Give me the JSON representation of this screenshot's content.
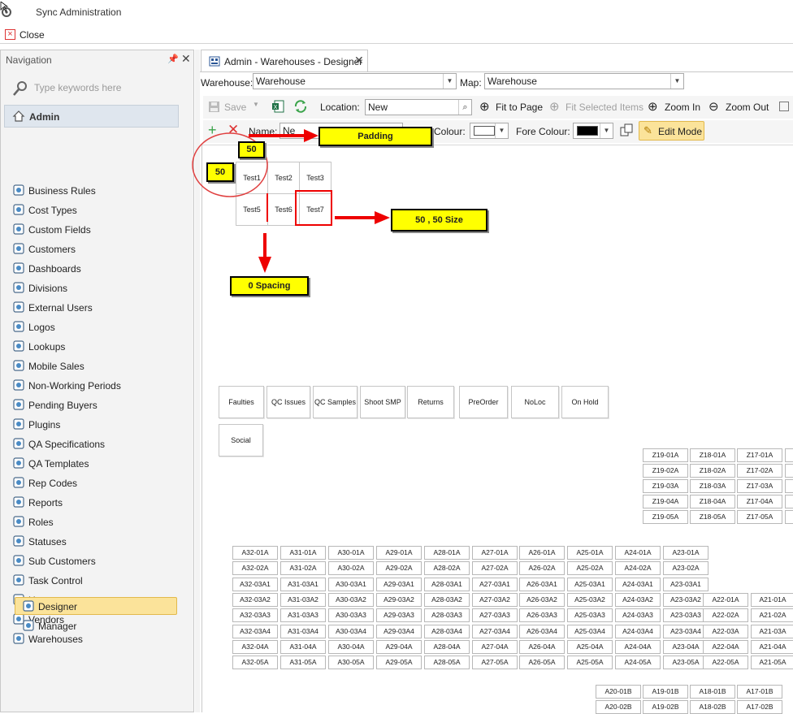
{
  "window": {
    "title": "Sync Administration",
    "close_label": "Close"
  },
  "nav": {
    "header": "Navigation",
    "search_placeholder": "Type keywords here",
    "group": "Admin",
    "items": [
      {
        "label": "Business Rules",
        "icon": "gears-icon"
      },
      {
        "label": "Cost Types",
        "icon": "cost-types-icon"
      },
      {
        "label": "Custom Fields",
        "icon": "custom-fields-icon"
      },
      {
        "label": "Customers",
        "icon": "user-icon"
      },
      {
        "label": "Dashboards",
        "icon": "dashboard-icon"
      },
      {
        "label": "Divisions",
        "icon": "hierarchy-icon"
      },
      {
        "label": "External Users",
        "icon": "external-user-icon"
      },
      {
        "label": "Logos",
        "icon": "logos-icon"
      },
      {
        "label": "Lookups",
        "icon": "lookup-icon"
      },
      {
        "label": "Mobile Sales",
        "icon": "mobile-sales-icon"
      },
      {
        "label": "Non-Working Periods",
        "icon": "calendar-icon"
      },
      {
        "label": "Pending Buyers",
        "icon": "pending-user-icon"
      },
      {
        "label": "Plugins",
        "icon": "plugin-icon"
      },
      {
        "label": "QA Specifications",
        "icon": "qa-spec-icon"
      },
      {
        "label": "QA Templates",
        "icon": "qa-template-icon"
      },
      {
        "label": "Rep Codes",
        "icon": "rep-codes-icon"
      },
      {
        "label": "Reports",
        "icon": "report-icon"
      },
      {
        "label": "Roles",
        "icon": "shield-icon"
      },
      {
        "label": "Statuses",
        "icon": "status-icon"
      },
      {
        "label": "Sub Customers",
        "icon": "sub-customers-icon"
      },
      {
        "label": "Task Control",
        "icon": "task-icon"
      },
      {
        "label": "Users",
        "icon": "user-icon"
      },
      {
        "label": "Vendors",
        "icon": "vendor-icon"
      },
      {
        "label": "Warehouses",
        "icon": "warehouse-icon"
      }
    ],
    "sub_items": [
      {
        "label": "Designer",
        "icon": "designer-icon",
        "selected": true
      },
      {
        "label": "Manager",
        "icon": "manager-icon",
        "selected": false
      }
    ]
  },
  "tab": {
    "label": "Admin - Warehouses - Designer"
  },
  "filters": {
    "warehouse_label": "Warehouse:",
    "warehouse_value": "Warehouse",
    "map_label": "Map:",
    "map_value": "Warehouse"
  },
  "toolbar": {
    "save": "Save",
    "location_label": "Location:",
    "location_value": "New",
    "fit_to_page": "Fit to Page",
    "fit_selected": "Fit Selected Items",
    "zoom_in": "Zoom In",
    "zoom_out": "Zoom Out"
  },
  "toolbar2": {
    "name_label": "Name:",
    "name_value": "Ne",
    "colour_label": "Colour:",
    "fore_colour_label": "Fore Colour:",
    "edit_mode": "Edit Mode",
    "colour_value": "#ffffff",
    "fore_colour_value": "#000000"
  },
  "annotations": {
    "padding": "Padding",
    "size": "50 , 50 Size",
    "spacing": "0 Spacing",
    "pad_top": "50",
    "pad_left": "50"
  },
  "test_cells": [
    "Test1",
    "Test2",
    "Test3",
    "Test5",
    "Test6",
    "Test7"
  ],
  "location_buttons": [
    "Faulties",
    "QC Issues",
    "QC Samples",
    "Shoot SMP",
    "Returns",
    "PreOrder",
    "NoLoc",
    "On Hold",
    "Social"
  ],
  "z_bins": [
    [
      "Z19-01A",
      "Z18-01A",
      "Z17-01A"
    ],
    [
      "Z19-02A",
      "Z18-02A",
      "Z17-02A"
    ],
    [
      "Z19-03A",
      "Z18-03A",
      "Z17-03A"
    ],
    [
      "Z19-04A",
      "Z18-04A",
      "Z17-04A"
    ],
    [
      "Z19-05A",
      "Z18-05A",
      "Z17-05A"
    ]
  ],
  "a_columns": [
    "A32",
    "A31",
    "A30",
    "A29",
    "A28",
    "A27",
    "A26",
    "A25",
    "A24",
    "A23"
  ],
  "a_suffixes": [
    "01A",
    "02A",
    "03A1",
    "03A2",
    "03A3",
    "03A4",
    "04A",
    "05A"
  ],
  "a_extra": {
    "A22": [
      "01A",
      "02A",
      "03A",
      "04A",
      "05A"
    ],
    "A21": [
      "01A",
      "02A",
      "03A",
      "04A",
      "05A"
    ]
  },
  "bottom_bins": [
    [
      "A20-01B",
      "A19-01B",
      "A18-01B",
      "A17-01B"
    ],
    [
      "A20-02B",
      "A19-02B",
      "A18-02B",
      "A17-02B"
    ]
  ]
}
